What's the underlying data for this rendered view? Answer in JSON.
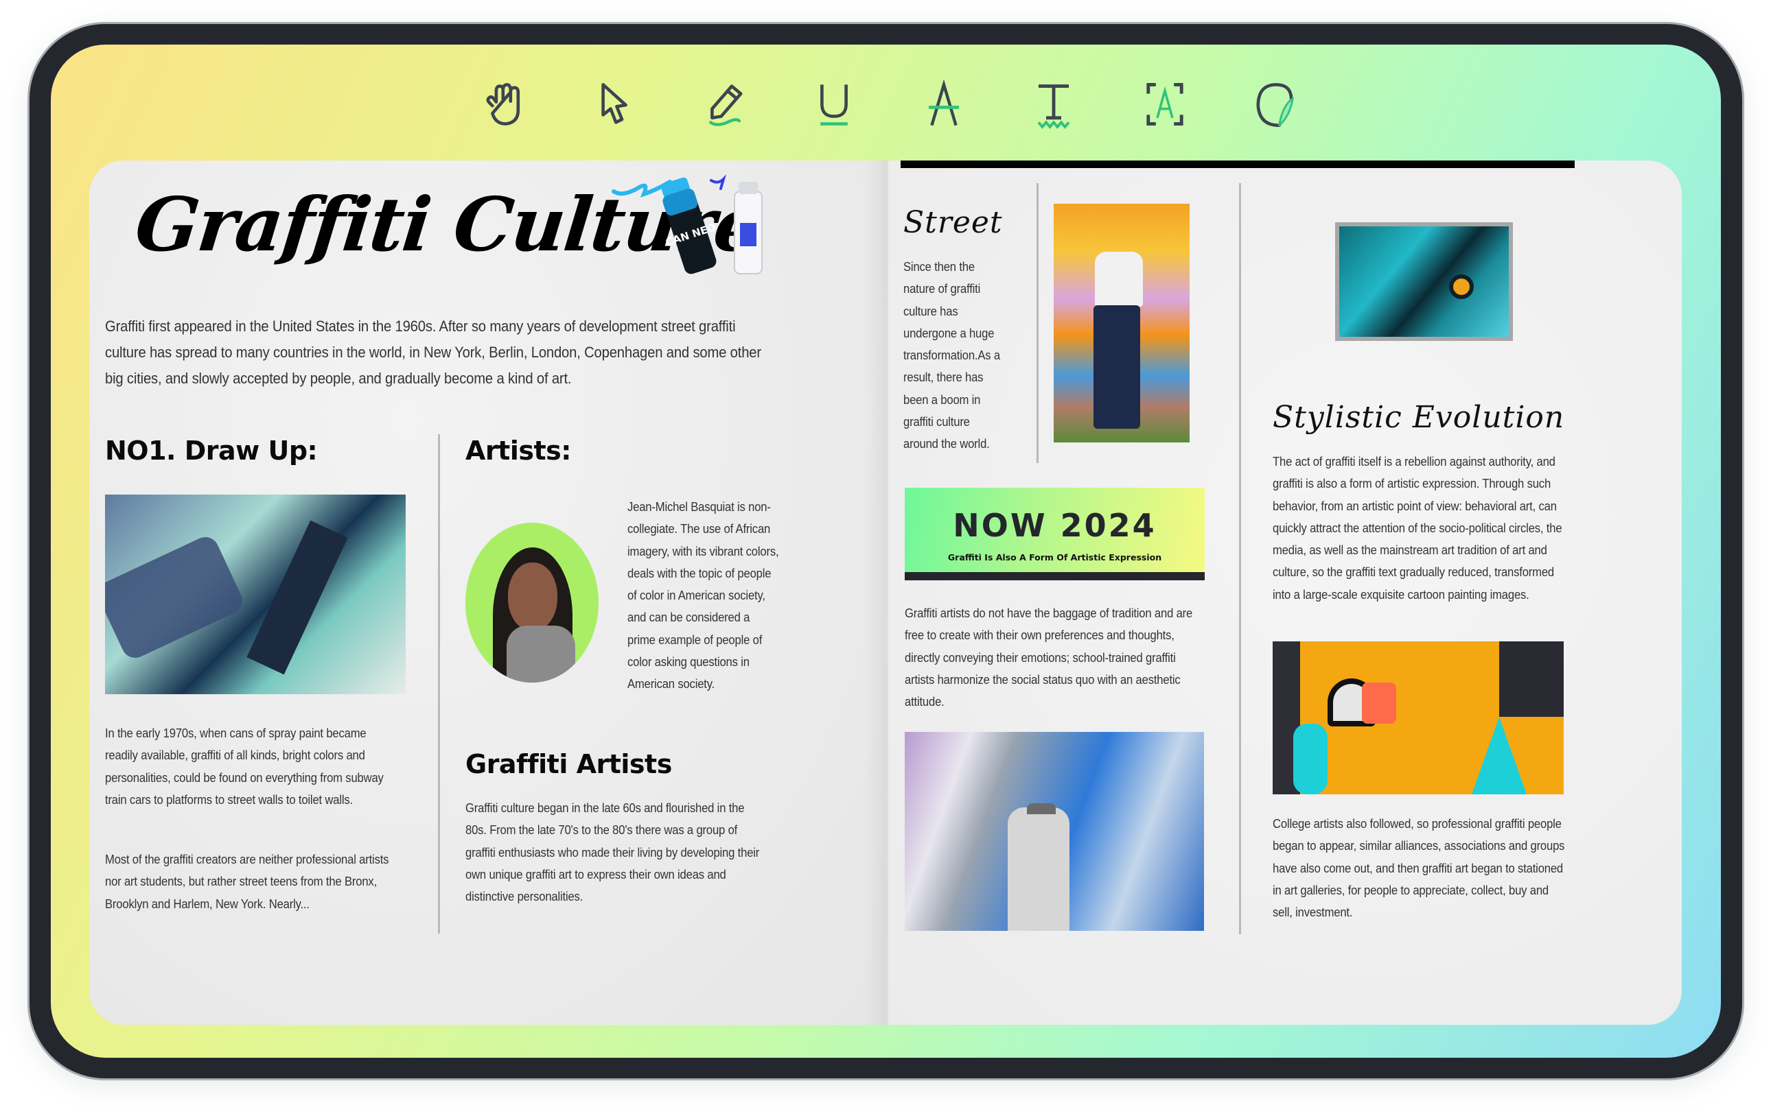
{
  "toolbar": {
    "tools": [
      {
        "name": "Hand",
        "icon": "hand-icon"
      },
      {
        "name": "Select",
        "icon": "cursor-icon"
      },
      {
        "name": "Pencil",
        "icon": "pencil-icon"
      },
      {
        "name": "Underline",
        "icon": "underline-icon"
      },
      {
        "name": "Strikethrough",
        "icon": "strikethrough-icon"
      },
      {
        "name": "Squiggly",
        "icon": "text-squiggly-icon"
      },
      {
        "name": "OCR",
        "icon": "ocr-icon"
      },
      {
        "name": "Signature",
        "icon": "signature-icon"
      }
    ],
    "accent_color": "#2fc27a",
    "icon_color": "#3d4450"
  },
  "document": {
    "left_page": {
      "title": "Graffiti Culture",
      "intro": "Graffiti first appeared in the United States in the 1960s. After so many years of development street graffiti culture has spread to many countries in the world, in New York, Berlin, London, Copenhagen and some other big cities, and slowly accepted by people, and gradually become a kind of art.",
      "draw_up": {
        "heading": "NO1. Draw Up:",
        "paragraph_1": "In the early 1970s, when cans of spray paint became readily available, graffiti of all kinds, bright colors and personalities, could be found on everything from subway train cars to platforms to street walls to toilet walls.",
        "paragraph_2": "Most of the graffiti creators are neither professional artists nor art students, but rather street teens from the Bronx, Brooklyn and Harlem, New York. Nearly..."
      },
      "artists": {
        "heading": "Artists:",
        "bio": "Jean-Michel Basquiat is non-collegiate. The use of African imagery, with its vibrant colors, deals with the topic of people of color in American society, and can be considered a prime example of people of color asking questions in American society."
      },
      "graffiti_artists": {
        "heading": "Graffiti Artists",
        "text": "Graffiti culture began in the late 60s and flourished in the 80s. From the late 70's to the 80's there was a group of graffiti enthusiasts who made their living by developing their own unique graffiti art to express their own ideas and distinctive personalities."
      }
    },
    "right_page": {
      "street": {
        "heading": "Street",
        "text": "Since then the nature of graffiti culture has undergone a huge transformation.As a result, there has been a boom in graffiti culture around the world."
      },
      "banner": {
        "title": "NOW 2024",
        "subtitle": "Graffiti Is Also A Form Of Artistic Expression"
      },
      "artists_text": "Graffiti artists do not have the baggage of tradition and are free to create with their own preferences and thoughts, directly conveying their emotions; school-trained graffiti artists harmonize the social status quo with an aesthetic attitude.",
      "stylistic": {
        "heading": "Stylistic Evolution",
        "text": "The act of graffiti itself is a rebellion against authority, and graffiti is also a form of artistic expression. Through such behavior, from an artistic point of view: behavioral art, can quickly attract the attention of the socio-political circles, the media, as well as the mainstream art tradition of art and culture, so the graffiti text gradually reduced, transformed into a large-scale exquisite cartoon painting images."
      },
      "college_text": "College artists also followed, so professional graffiti people began to appear, similar alliances, associations and groups have also come out, and then graffiti art began to stationed in art galleries, for people to appreciate, collect, buy and sell, investment."
    },
    "spray_can_label": "CAN NEO"
  }
}
